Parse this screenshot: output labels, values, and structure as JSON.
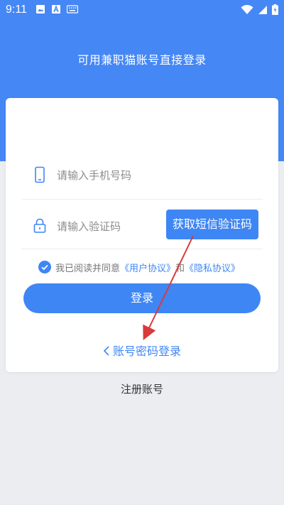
{
  "status_bar": {
    "time": "9:11",
    "icons_left": [
      "image-icon",
      "a-letter-icon",
      "keyboard-icon"
    ],
    "icons_right": [
      "wifi-icon",
      "signal-icon",
      "battery-icon"
    ]
  },
  "header": {
    "title": "可用兼职猫账号直接登录"
  },
  "form": {
    "phone_placeholder": "请输入手机号码",
    "code_placeholder": "请输入验证码",
    "sms_button_label": "获取短信验证码",
    "agreement": {
      "prefix": "我已阅读并同意",
      "user_agreement": "《用户协议》",
      "and": "和",
      "privacy_agreement": "《隐私协议》",
      "checked": true
    },
    "login_label": "登录",
    "password_login_label": "账号密码登录"
  },
  "register_label": "注册账号",
  "colors": {
    "primary": "#3f86f5",
    "header_bg": "#4587f5",
    "page_bg": "#ebedf0",
    "annotation_arrow": "#d93a3a"
  }
}
